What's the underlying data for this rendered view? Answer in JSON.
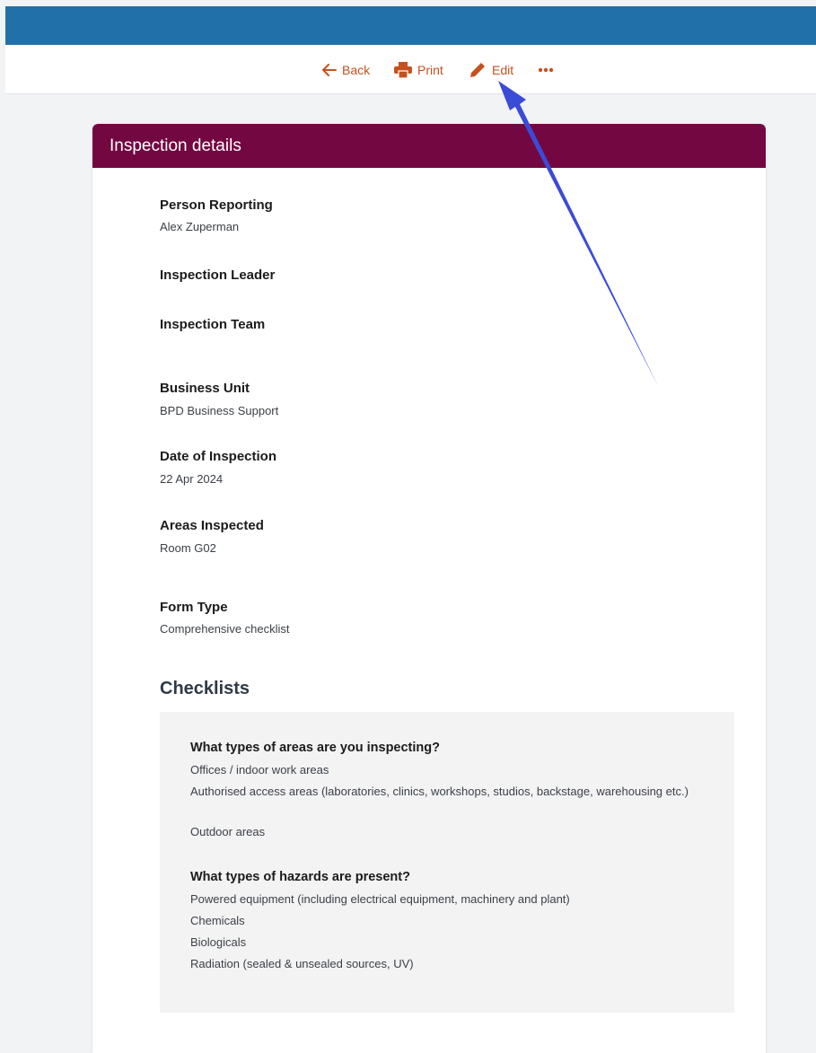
{
  "toolbar": {
    "back_label": "Back",
    "print_label": "Print",
    "edit_label": "Edit"
  },
  "card": {
    "title": "Inspection details",
    "fields": {
      "person_reporting": {
        "label": "Person Reporting",
        "value": "Alex Zuperman"
      },
      "inspection_leader": {
        "label": "Inspection Leader",
        "value": ""
      },
      "inspection_team": {
        "label": "Inspection Team",
        "value": ""
      },
      "business_unit": {
        "label": "Business Unit",
        "value": "BPD Business Support"
      },
      "date_of_inspection": {
        "label": "Date of Inspection",
        "value": "22 Apr 2024"
      },
      "areas_inspected": {
        "label": "Areas Inspected",
        "value": "Room G02"
      },
      "form_type": {
        "label": "Form Type",
        "value": "Comprehensive checklist"
      }
    },
    "checklists": {
      "title": "Checklists",
      "questions": [
        {
          "question": "What types of areas are you inspecting?",
          "answers": [
            "Offices / indoor work areas",
            "Authorised access areas (laboratories, clinics, workshops, studios, backstage, warehousing etc.)",
            "Outdoor areas"
          ]
        },
        {
          "question": "What types of hazards are present?",
          "answers": [
            "Powered equipment (including electrical equipment, machinery and plant)",
            "Chemicals",
            "Biologicals",
            "Radiation (sealed & unsealed sources, UV)"
          ]
        }
      ]
    }
  },
  "colors": {
    "topbar": "#2270aa",
    "card_header": "#730741",
    "toolbar_accent": "#c4511f",
    "annotation_arrow": "#3b4bd8"
  },
  "icons": {
    "back": "arrow-left-icon",
    "print": "printer-icon",
    "edit": "pencil-icon",
    "more": "ellipsis-icon"
  }
}
